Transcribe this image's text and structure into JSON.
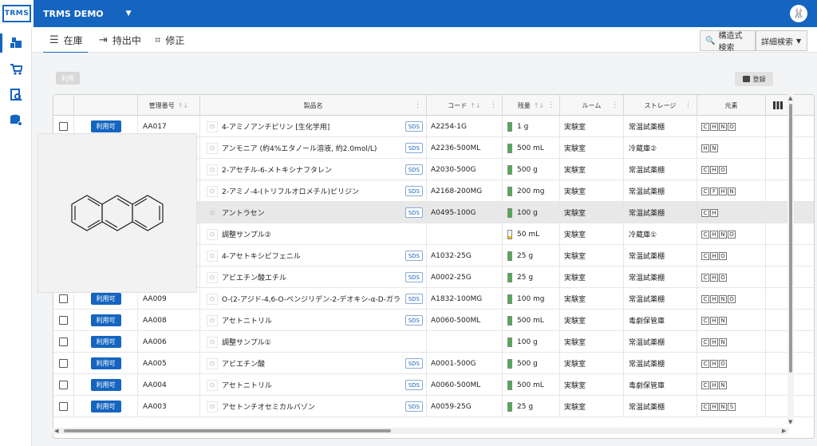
{
  "app": {
    "logo_text": "TRMS",
    "title": "TRMS DEMO",
    "avatar": "rabbit-avatar"
  },
  "colors": {
    "brand": "#1565c0",
    "status_available": "#1565c0",
    "level_ok": "#4caf50",
    "level_low": "#f2c200"
  },
  "tabs": [
    {
      "label": "在庫",
      "icon": "list-icon",
      "active": true
    },
    {
      "label": "持出中",
      "icon": "checkout-icon",
      "active": false
    },
    {
      "label": "修正",
      "icon": "edit-icon",
      "active": false
    }
  ],
  "search": {
    "structure_label": "構造式検索",
    "detail_label": "詳細検索"
  },
  "toolbar": {
    "use_label": "利用",
    "register_label": "登録"
  },
  "columns": {
    "mgmt_no": "管理番号",
    "product": "製品名",
    "code": "コード",
    "amount": "残量",
    "room": "ルーム",
    "storage": "ストレージ",
    "elements": "元素"
  },
  "rows": [
    {
      "status": "利用可",
      "id": "AA017",
      "name": "4-アミノアンチピリン [生化学用]",
      "sds": "SDS",
      "code": "A2254-1G",
      "amount": "1 g",
      "level": 1.0,
      "room": "実験室",
      "storage": "常温試薬棚",
      "elements": [
        "C",
        "H",
        "N",
        "O"
      ]
    },
    {
      "status": "利用可",
      "id": "",
      "name": "アンモニア (約4%エタノール溶液, 約2.0mol/L)",
      "sds": "SDS",
      "code": "A2236-500ML",
      "amount": "500 mL",
      "level": 1.0,
      "room": "実験室",
      "storage": "冷蔵庫②",
      "elements": [
        "H",
        "N"
      ]
    },
    {
      "status": "利用可",
      "id": "",
      "name": "2-アセチル-6-メトキシナフタレン",
      "sds": "SDS",
      "code": "A2030-500G",
      "amount": "500 g",
      "level": 1.0,
      "room": "実験室",
      "storage": "常温試薬棚",
      "elements": [
        "C",
        "H",
        "O"
      ]
    },
    {
      "status": "利用可",
      "id": "",
      "name": "2-アミノ-4-(トリフルオロメチル)ピリジン",
      "sds": "SDS",
      "code": "A2168-200MG",
      "amount": "200 mg",
      "level": 1.0,
      "room": "実験室",
      "storage": "常温試薬棚",
      "elements": [
        "C",
        "F",
        "H",
        "N"
      ]
    },
    {
      "status": "利用可",
      "id": "",
      "name": "アントラセン",
      "sds": "SDS",
      "code": "A0495-100G",
      "amount": "100 g",
      "level": 1.0,
      "room": "実験室",
      "storage": "常温試薬棚",
      "elements": [
        "C",
        "H"
      ]
    },
    {
      "status": "利用可",
      "id": "",
      "name": "調整サンプル②",
      "sds": "",
      "code": "",
      "amount": "50 mL",
      "level": 0.3,
      "room": "実験室",
      "storage": "冷蔵庫①",
      "elements": [
        "C",
        "H",
        "N",
        "O"
      ]
    },
    {
      "status": "利用可",
      "id": "",
      "name": "4-アセトキシビフェニル",
      "sds": "SDS",
      "code": "A1032-25G",
      "amount": "25 g",
      "level": 1.0,
      "room": "実験室",
      "storage": "常温試薬棚",
      "elements": [
        "C",
        "H",
        "O"
      ]
    },
    {
      "status": "利用可",
      "id": "",
      "name": "アビエチン酸エチル",
      "sds": "SDS",
      "code": "A0002-25G",
      "amount": "25 g",
      "level": 1.0,
      "room": "実験室",
      "storage": "常温試薬棚",
      "elements": [
        "C",
        "H",
        "O"
      ]
    },
    {
      "status": "利用可",
      "id": "AA009",
      "name": "O-(2-アジド-4,6-O-ベンジリデン-2-デオキシ-α-D-ガラ",
      "sds": "SDS",
      "code": "A1832-100MG",
      "amount": "100 mg",
      "level": 1.0,
      "room": "実験室",
      "storage": "常温試薬棚",
      "elements": [
        "C",
        "H",
        "N",
        "O"
      ]
    },
    {
      "status": "利用可",
      "id": "AA008",
      "name": "アセトニトリル",
      "sds": "SDS",
      "code": "A0060-500ML",
      "amount": "500 mL",
      "level": 1.0,
      "room": "実験室",
      "storage": "毒劇保管庫",
      "elements": [
        "C",
        "H",
        "N"
      ]
    },
    {
      "status": "利用可",
      "id": "AA006",
      "name": "調整サンプル①",
      "sds": "",
      "code": "",
      "amount": "100 g",
      "level": 1.0,
      "room": "実験室",
      "storage": "常温試薬棚",
      "elements": [
        "C",
        "H",
        "N"
      ]
    },
    {
      "status": "利用可",
      "id": "AA005",
      "name": "アビエチン酸",
      "sds": "SDS",
      "code": "A0001-500G",
      "amount": "500 g",
      "level": 1.0,
      "room": "実験室",
      "storage": "常温試薬棚",
      "elements": [
        "C",
        "H",
        "O"
      ]
    },
    {
      "status": "利用可",
      "id": "AA004",
      "name": "アセトニトリル",
      "sds": "SDS",
      "code": "A0060-500ML",
      "amount": "500 mL",
      "level": 1.0,
      "room": "実験室",
      "storage": "毒劇保管庫",
      "elements": [
        "C",
        "H",
        "N"
      ]
    },
    {
      "status": "利用可",
      "id": "AA003",
      "name": "アセトンチオセミカルバゾン",
      "sds": "SDS",
      "code": "A0059-25G",
      "amount": "25 g",
      "level": 1.0,
      "room": "実験室",
      "storage": "常温試薬棚",
      "elements": [
        "C",
        "H",
        "N",
        "S"
      ]
    }
  ],
  "selected_row": 4,
  "popover": {
    "structure": "anthracene-structure"
  }
}
